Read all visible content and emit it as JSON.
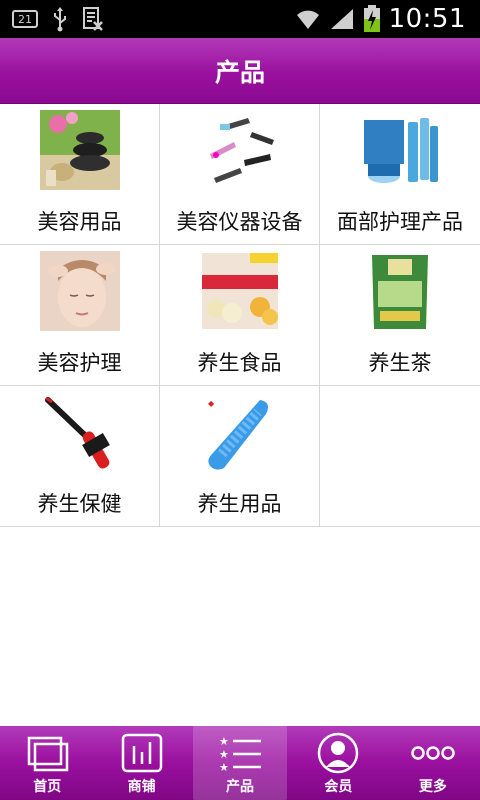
{
  "status_bar": {
    "notification_badge": "21",
    "time": "10:51",
    "icons": [
      "usb-icon",
      "document-icon",
      "wifi-icon",
      "signal-icon",
      "battery-charging-icon"
    ]
  },
  "header": {
    "title": "产品"
  },
  "grid": {
    "items": [
      {
        "label": "美容用品",
        "icon": "spa-stones-image"
      },
      {
        "label": "美容仪器设备",
        "icon": "beauty-devices-image"
      },
      {
        "label": "面部护理产品",
        "icon": "skincare-bottles-image"
      },
      {
        "label": "美容护理",
        "icon": "facial-massage-image"
      },
      {
        "label": "养生食品",
        "icon": "health-food-package-image"
      },
      {
        "label": "养生茶",
        "icon": "tea-package-image"
      },
      {
        "label": "养生保健",
        "icon": "massage-hammer-image"
      },
      {
        "label": "养生用品",
        "icon": "massage-brush-image"
      }
    ]
  },
  "bottom_nav": {
    "items": [
      {
        "label": "首页",
        "icon": "home-icon"
      },
      {
        "label": "商铺",
        "icon": "shop-icon"
      },
      {
        "label": "产品",
        "icon": "list-icon"
      },
      {
        "label": "会员",
        "icon": "user-icon"
      },
      {
        "label": "更多",
        "icon": "more-icon"
      }
    ],
    "active_index": 2
  },
  "colors": {
    "accent": "#9a109f",
    "divider": "#d6d6d6"
  }
}
